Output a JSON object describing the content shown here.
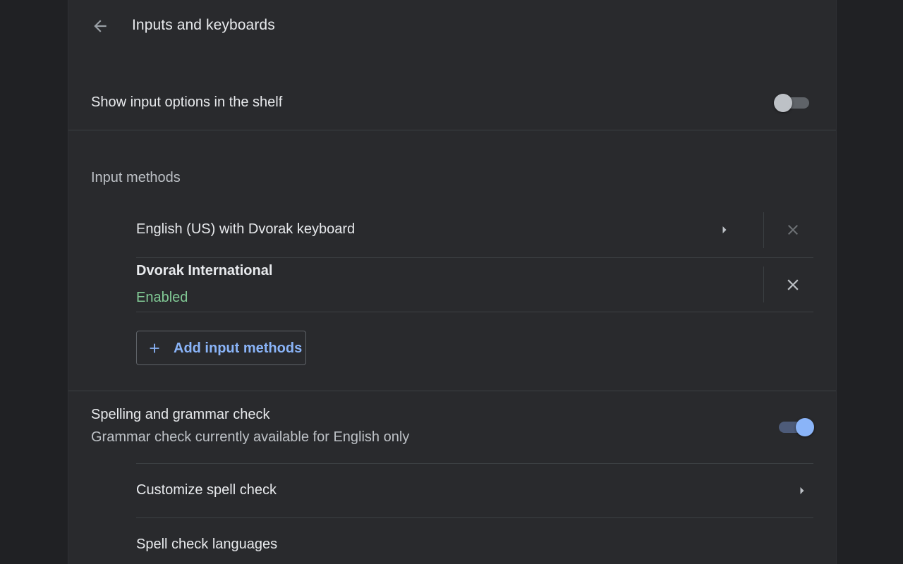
{
  "header": {
    "title": "Inputs and keyboards",
    "back_icon": "arrow-back-icon"
  },
  "shelf_option": {
    "label": "Show input options in the shelf",
    "toggle_state": "off"
  },
  "input_methods": {
    "section_title": "Input methods",
    "items": [
      {
        "name": "English (US) with Dvorak keyboard",
        "status": "",
        "has_submenu": true,
        "remove_enabled": false
      },
      {
        "name": "Dvorak International",
        "status": "Enabled",
        "has_submenu": false,
        "remove_enabled": true
      }
    ],
    "add_button_label": "Add input methods"
  },
  "spell_check": {
    "label": "Spelling and grammar check",
    "sublabel": "Grammar check currently available for English only",
    "toggle_state": "on",
    "items": [
      {
        "label": "Customize spell check",
        "has_submenu": true
      },
      {
        "label": "Spell check languages",
        "has_submenu": false
      }
    ]
  },
  "colors": {
    "background": "#202124",
    "panel": "#292a2d",
    "accent": "#8ab4f8",
    "enabled_status": "#81c995"
  }
}
